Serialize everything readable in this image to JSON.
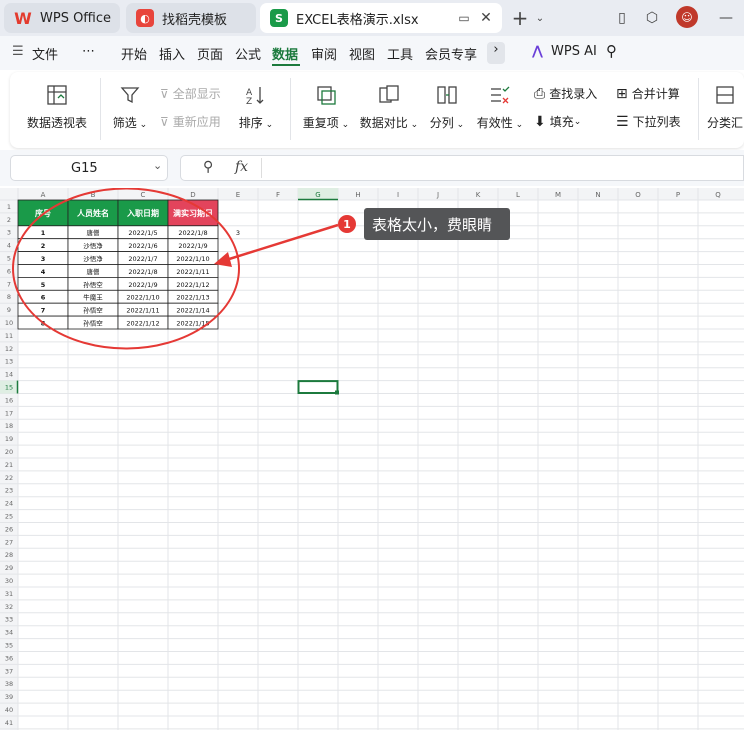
{
  "tabs": {
    "wps": "WPS Office",
    "template": "找稻壳模板",
    "excel": "EXCEL表格演示.xlsx"
  },
  "menu": {
    "file": "文件",
    "more": "⋯",
    "items": [
      "开始",
      "插入",
      "页面",
      "公式",
      "数据",
      "审阅",
      "视图",
      "工具",
      "会员专享"
    ],
    "wps_ai": "WPS AI"
  },
  "ribbon": {
    "pivot": "数据透视表",
    "filter": "筛选",
    "show_all": "全部显示",
    "reapply": "重新应用",
    "sort": "排序",
    "duplicates": "重复项",
    "compare": "数据对比",
    "split": "分列",
    "validity": "有效性",
    "lookup": "查找录入",
    "fill": "填充",
    "consolidate": "合并计算",
    "dropdown": "下拉列表",
    "subtotal": "分类汇"
  },
  "formula_bar": {
    "cell_ref": "G15",
    "fx": "fx",
    "value": ""
  },
  "sheet": {
    "columns": [
      "A",
      "B",
      "C",
      "D",
      "E",
      "F",
      "G",
      "H",
      "I",
      "J",
      "K",
      "L",
      "M",
      "N",
      "O",
      "P",
      "Q"
    ],
    "headers": [
      "序号",
      "人员姓名",
      "入职日期",
      "满实习期日"
    ],
    "rows": [
      [
        "1",
        "唐僧",
        "2022/1/5",
        "2022/1/8"
      ],
      [
        "2",
        "沙悟净",
        "2022/1/6",
        "2022/1/9"
      ],
      [
        "3",
        "沙悟净",
        "2022/1/7",
        "2022/1/10"
      ],
      [
        "4",
        "唐僧",
        "2022/1/8",
        "2022/1/11"
      ],
      [
        "5",
        "孙悟空",
        "2022/1/9",
        "2022/1/12"
      ],
      [
        "6",
        "牛魔王",
        "2022/1/10",
        "2022/1/13"
      ],
      [
        "7",
        "孙悟空",
        "2022/1/11",
        "2022/1/14"
      ],
      [
        "8",
        "孙悟空",
        "2022/1/12",
        "2022/1/15"
      ]
    ],
    "e2_value": "3",
    "selected_cell": "G15"
  },
  "annotation": {
    "number": "1",
    "text": "表格太小，费眼睛"
  },
  "colors": {
    "header_green": "#1a9a49",
    "header_red": "#e3445c",
    "accent": "#1c7a3d",
    "annotation_red": "#e53935"
  }
}
